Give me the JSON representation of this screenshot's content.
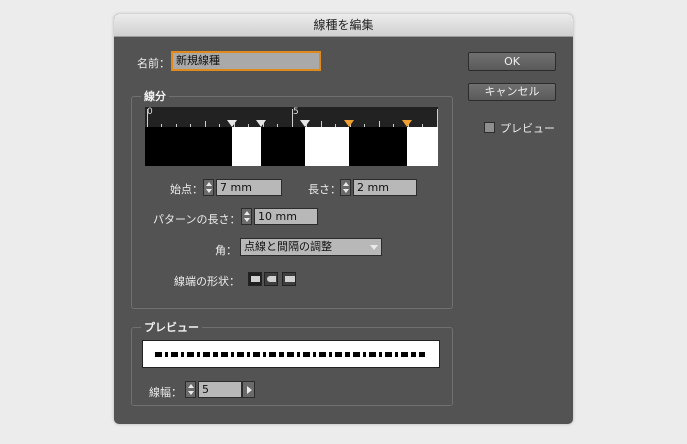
{
  "dialog": {
    "title": "線種を編集"
  },
  "name": {
    "label": "名前：",
    "value": "新規線種"
  },
  "buttons": {
    "ok": "OK",
    "cancel": "キャンセル"
  },
  "preview_check": {
    "label": "プレビュー",
    "checked": false
  },
  "segments": {
    "group_title": "線分",
    "ruler_labels": [
      "0",
      "5"
    ],
    "start": {
      "label": "始点：",
      "value": "7 mm"
    },
    "length": {
      "label": "長さ：",
      "value": "2 mm"
    },
    "pattern_length": {
      "label": "パターンの長さ：",
      "value": "10 mm"
    },
    "corner": {
      "label": "角：",
      "value": "点線と間隔の調整"
    },
    "cap": {
      "label": "線端の形状："
    }
  },
  "preview": {
    "group_title": "プレビュー"
  },
  "stroke_width": {
    "label": "線幅：",
    "value": "5"
  },
  "colors": {
    "dialog_bg": "#535353",
    "field_bg": "#b8b8b8",
    "accent": "#e08a1e",
    "selected_marker": "#f0a030"
  }
}
